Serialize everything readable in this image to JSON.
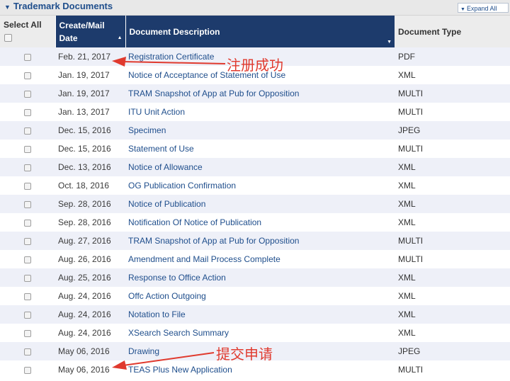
{
  "section": {
    "title": "Trademark Documents",
    "expand_label": "Expand All"
  },
  "headers": {
    "select_all": "Select All",
    "date_line1": "Create/Mail",
    "date_line2": "Date",
    "description": "Document Description",
    "type": "Document Type"
  },
  "rows": [
    {
      "date": "Feb. 21, 2017",
      "description": "Registration Certificate",
      "type": "PDF"
    },
    {
      "date": "Jan. 19, 2017",
      "description": "Notice of Acceptance of Statement of Use",
      "type": "XML"
    },
    {
      "date": "Jan. 19, 2017",
      "description": "TRAM Snapshot of App at Pub for Opposition",
      "type": "MULTI"
    },
    {
      "date": "Jan. 13, 2017",
      "description": "ITU Unit Action",
      "type": "MULTI"
    },
    {
      "date": "Dec. 15, 2016",
      "description": "Specimen",
      "type": "JPEG"
    },
    {
      "date": "Dec. 15, 2016",
      "description": "Statement of Use",
      "type": "MULTI"
    },
    {
      "date": "Dec. 13, 2016",
      "description": "Notice of Allowance",
      "type": "XML"
    },
    {
      "date": "Oct. 18, 2016",
      "description": "OG Publication Confirmation",
      "type": "XML"
    },
    {
      "date": "Sep. 28, 2016",
      "description": "Notice of Publication",
      "type": "XML"
    },
    {
      "date": "Sep. 28, 2016",
      "description": "Notification Of Notice of Publication",
      "type": "XML"
    },
    {
      "date": "Aug. 27, 2016",
      "description": "TRAM Snapshot of App at Pub for Opposition",
      "type": "MULTI"
    },
    {
      "date": "Aug. 26, 2016",
      "description": "Amendment and Mail Process Complete",
      "type": "MULTI"
    },
    {
      "date": "Aug. 25, 2016",
      "description": "Response to Office Action",
      "type": "XML"
    },
    {
      "date": "Aug. 24, 2016",
      "description": "Offc Action Outgoing",
      "type": "XML"
    },
    {
      "date": "Aug. 24, 2016",
      "description": "Notation to File",
      "type": "XML"
    },
    {
      "date": "Aug. 24, 2016",
      "description": "XSearch Search Summary",
      "type": "XML"
    },
    {
      "date": "May 06, 2016",
      "description": "Drawing",
      "type": "JPEG"
    },
    {
      "date": "May 06, 2016",
      "description": "TEAS Plus New Application",
      "type": "MULTI"
    }
  ],
  "annotations": {
    "registered": "注册成功",
    "submitted": "提交申请",
    "color": "#e03a2e"
  },
  "colors": {
    "header_dark": "#1d3b6c",
    "link": "#1f4e8c",
    "row_alt": "#eef0f8"
  }
}
